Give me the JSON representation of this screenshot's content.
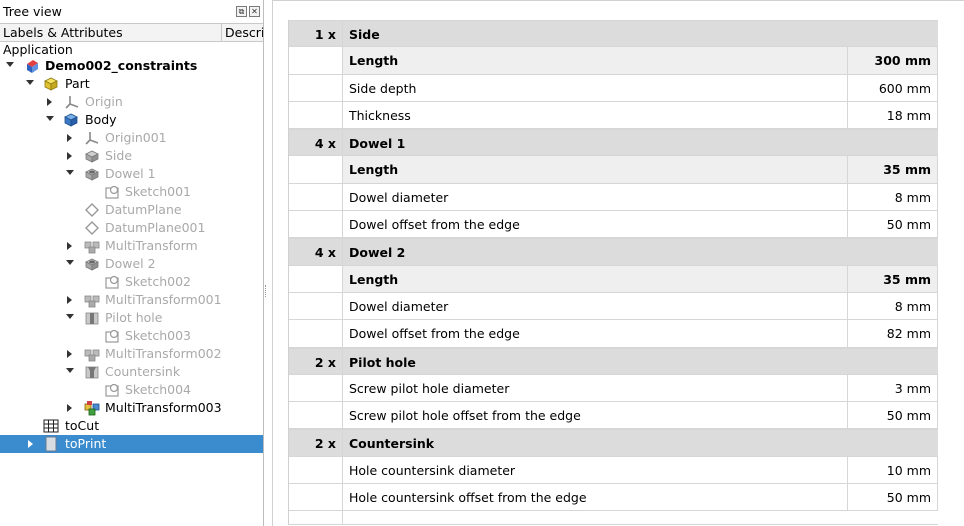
{
  "tree_panel": {
    "title": "Tree view",
    "float_glyph": "⧉",
    "close_glyph": "✕",
    "col_labels": "Labels & Attributes",
    "col_description": "Description",
    "root_label": "Application",
    "items": [
      {
        "label": "Demo002_constraints",
        "icon": "document-icon"
      },
      {
        "label": "Part",
        "icon": "part-icon"
      },
      {
        "label": "Origin",
        "icon": "origin-icon"
      },
      {
        "label": "Body",
        "icon": "body-icon"
      },
      {
        "label": "Origin001",
        "icon": "origin-icon"
      },
      {
        "label": "Side",
        "icon": "pad-icon"
      },
      {
        "label": "Dowel 1",
        "icon": "pocket-icon"
      },
      {
        "label": "Sketch001",
        "icon": "sketch-icon"
      },
      {
        "label": "DatumPlane",
        "icon": "datum-plane-icon"
      },
      {
        "label": "DatumPlane001",
        "icon": "datum-plane-icon"
      },
      {
        "label": "MultiTransform",
        "icon": "multitransform-icon"
      },
      {
        "label": "Dowel 2",
        "icon": "pocket-icon"
      },
      {
        "label": "Sketch002",
        "icon": "sketch-icon"
      },
      {
        "label": "MultiTransform001",
        "icon": "multitransform-icon"
      },
      {
        "label": "Pilot hole",
        "icon": "hole-icon"
      },
      {
        "label": "Sketch003",
        "icon": "sketch-icon"
      },
      {
        "label": "MultiTransform002",
        "icon": "multitransform-icon"
      },
      {
        "label": "Countersink",
        "icon": "hole-icon"
      },
      {
        "label": "Sketch004",
        "icon": "sketch-icon"
      },
      {
        "label": "MultiTransform003",
        "icon": "multitransform-tip-icon"
      },
      {
        "label": "toCut",
        "icon": "spreadsheet-icon"
      },
      {
        "label": "toPrint",
        "icon": "spreadsheet-icon"
      }
    ]
  },
  "sheet": {
    "rows": [
      {
        "qty": "1 x",
        "name": "Side",
        "value": "",
        "kind": "section"
      },
      {
        "qty": "",
        "name": "Length",
        "value": "300 mm",
        "kind": "primary"
      },
      {
        "qty": "",
        "name": "Side depth",
        "value": "600 mm",
        "kind": "normal"
      },
      {
        "qty": "",
        "name": "Thickness",
        "value": "18 mm",
        "kind": "normal"
      },
      {
        "qty": "4 x",
        "name": "Dowel 1",
        "value": "",
        "kind": "section"
      },
      {
        "qty": "",
        "name": "Length",
        "value": "35 mm",
        "kind": "primary"
      },
      {
        "qty": "",
        "name": "Dowel diameter",
        "value": "8 mm",
        "kind": "normal"
      },
      {
        "qty": "",
        "name": "Dowel offset from the edge",
        "value": "50 mm",
        "kind": "normal"
      },
      {
        "qty": "4 x",
        "name": "Dowel 2",
        "value": "",
        "kind": "section"
      },
      {
        "qty": "",
        "name": "Length",
        "value": "35 mm",
        "kind": "primary"
      },
      {
        "qty": "",
        "name": "Dowel diameter",
        "value": "8 mm",
        "kind": "normal"
      },
      {
        "qty": "",
        "name": "Dowel offset from the edge",
        "value": "82 mm",
        "kind": "normal"
      },
      {
        "qty": "2 x",
        "name": "Pilot hole",
        "value": "",
        "kind": "section"
      },
      {
        "qty": "",
        "name": "Screw pilot hole diameter",
        "value": "3 mm",
        "kind": "normal"
      },
      {
        "qty": "",
        "name": "Screw pilot hole offset from the edge",
        "value": "50 mm",
        "kind": "normal"
      },
      {
        "qty": "2 x",
        "name": "Countersink",
        "value": "",
        "kind": "section"
      },
      {
        "qty": "",
        "name": "Hole countersink diameter",
        "value": "10 mm",
        "kind": "normal"
      },
      {
        "qty": "",
        "name": "Hole countersink offset from the edge",
        "value": "50 mm",
        "kind": "normal"
      }
    ]
  }
}
